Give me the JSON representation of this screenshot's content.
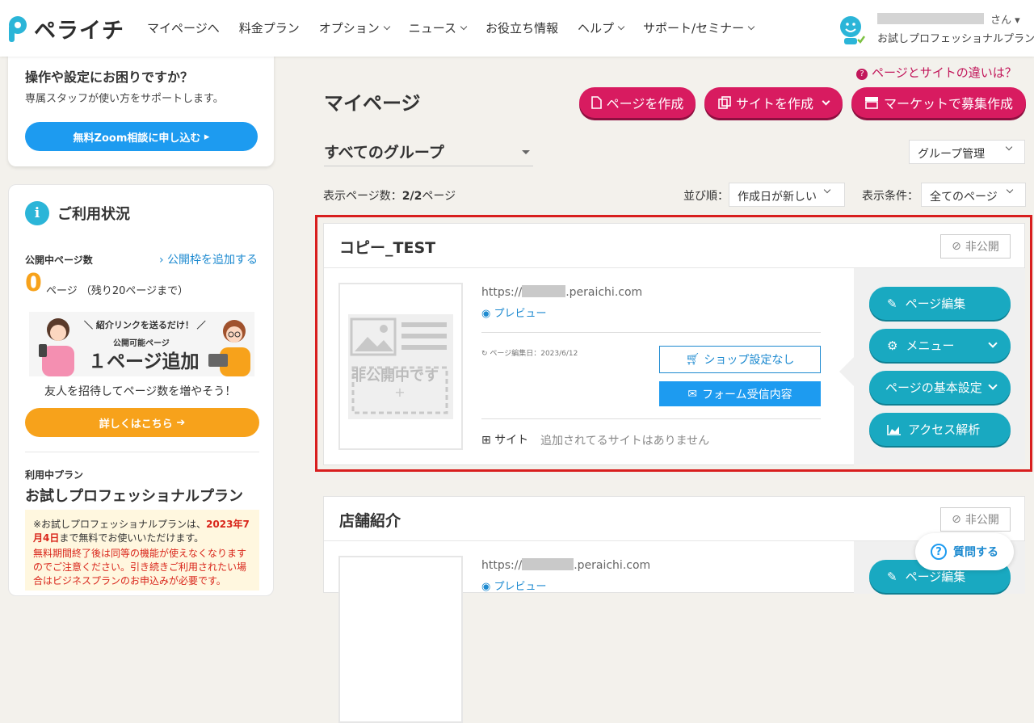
{
  "header": {
    "logo_text": "ペライチ",
    "nav": [
      {
        "label": "マイページへ",
        "dropdown": false
      },
      {
        "label": "料金プラン",
        "dropdown": false
      },
      {
        "label": "オプション",
        "dropdown": true
      },
      {
        "label": "ニュース",
        "dropdown": true
      },
      {
        "label": "お役立ち情報",
        "dropdown": false
      },
      {
        "label": "ヘルプ",
        "dropdown": true
      },
      {
        "label": "サポート/セミナー",
        "dropdown": true
      }
    ],
    "user_suffix": "さん",
    "user_plan": "お試しプロフェッショナルプラン"
  },
  "sidebar": {
    "trouble": {
      "title": "操作や設定にお困りですか？",
      "subtitle": "専属スタッフが使い方をサポートします。",
      "button": "無料Zoom相談に申し込む"
    },
    "usage": {
      "title": "ご利用状況",
      "published_label": "公開中ページ数",
      "add_link": "公開枠を追加する",
      "count": "0",
      "count_text": "ページ （残り20ページまで）",
      "banner": {
        "line1": "＼ 紹介リンクを送るだけ！ ／",
        "line2": "公開可能ページ",
        "line3": "１ページ追加"
      },
      "invite_text": "友人を招待してページ数を増やそう！",
      "more_button": "詳しくはこちら",
      "plan_label": "利用中プラン",
      "plan_name": "お試しプロフェッショナルプラン",
      "notice_pre": "※お試しプロフェッショナルプランは、",
      "notice_date": "2023年7月4日",
      "notice_post": "まで無料でお使いいただけます。",
      "notice2": "無料期間終了後は同等の機能が使えなくなりますのでご注意ください。引き続きご利用されたい場合はビジネスプランのお申込みが必要です。"
    }
  },
  "main": {
    "help_link": "ページとサイトの違いは？",
    "title": "マイページ",
    "buttons": {
      "create_page": "ページを作成",
      "create_site": "サイトを作成",
      "market": "マーケットで募集作成"
    },
    "group_select": "すべてのグループ",
    "group_manage": "グループ管理",
    "count_label": "表示ページ数：",
    "count_value": "2/2",
    "count_suffix": "ページ",
    "sort_label": "並び順：",
    "sort_value": "作成日が新しい",
    "filter_label": "表示条件：",
    "filter_value": "全てのページ",
    "pages": [
      {
        "title": "コピー_TEST",
        "status": "非公開",
        "thumb_text": "非公開中です",
        "url_prefix": "https://",
        "url_suffix": ".peraichi.com",
        "preview": "プレビュー",
        "edited": "ページ編集日：2023/6/12",
        "shop": "ショップ設定なし",
        "form": "フォーム受信内容",
        "site_label": "サイト",
        "site_value": "追加されてるサイトはありません",
        "actions": {
          "edit": "ページ編集",
          "menu": "メニュー",
          "basic": "ページの基本設定",
          "analytics": "アクセス解析"
        }
      },
      {
        "title": "店舗紹介",
        "status": "非公開",
        "url_prefix": "https://",
        "url_suffix": ".peraichi.com",
        "preview": "プレビュー",
        "actions": {
          "edit": "ページ編集"
        }
      }
    ]
  },
  "question_bubble": "質問する",
  "colors": {
    "brand_pink": "#d81b60",
    "teal": "#19a9c1",
    "blue": "#1d9bf0",
    "orange": "#f7a21b",
    "highlight": "#d81e1e"
  }
}
